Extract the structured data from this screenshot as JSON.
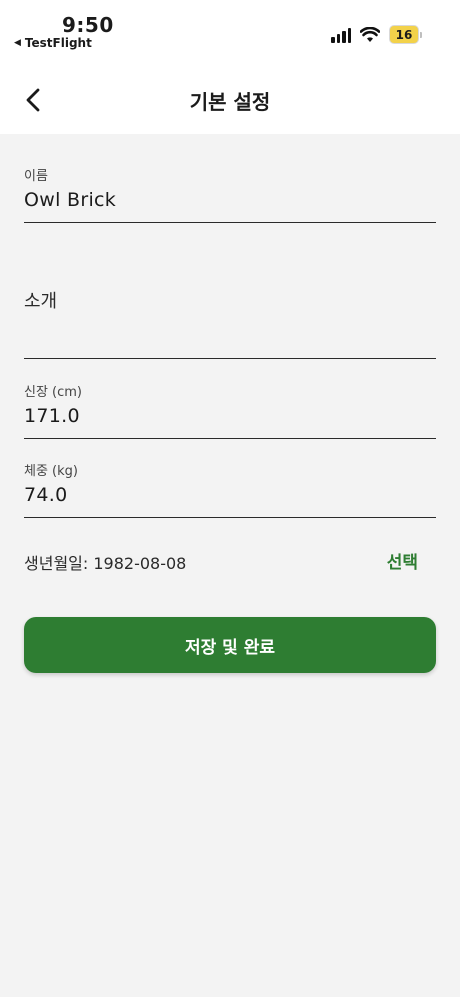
{
  "status_bar": {
    "time": "9:50",
    "back_app": "TestFlight",
    "battery": "16"
  },
  "nav": {
    "title": "기본 설정"
  },
  "form": {
    "name": {
      "label": "이름",
      "value": "Owl Brick"
    },
    "intro": {
      "label": "소개",
      "value": ""
    },
    "height": {
      "label": "신장 (cm)",
      "value": "171.0"
    },
    "weight": {
      "label": "체중 (kg)",
      "value": "74.0"
    },
    "birth": {
      "text": "생년월일: 1982-08-08",
      "select_label": "선택"
    }
  },
  "actions": {
    "save_label": "저장 및 완료"
  },
  "colors": {
    "accent": "#2e7d32",
    "background": "#f3f3f3",
    "battery": "#f3d24a"
  }
}
